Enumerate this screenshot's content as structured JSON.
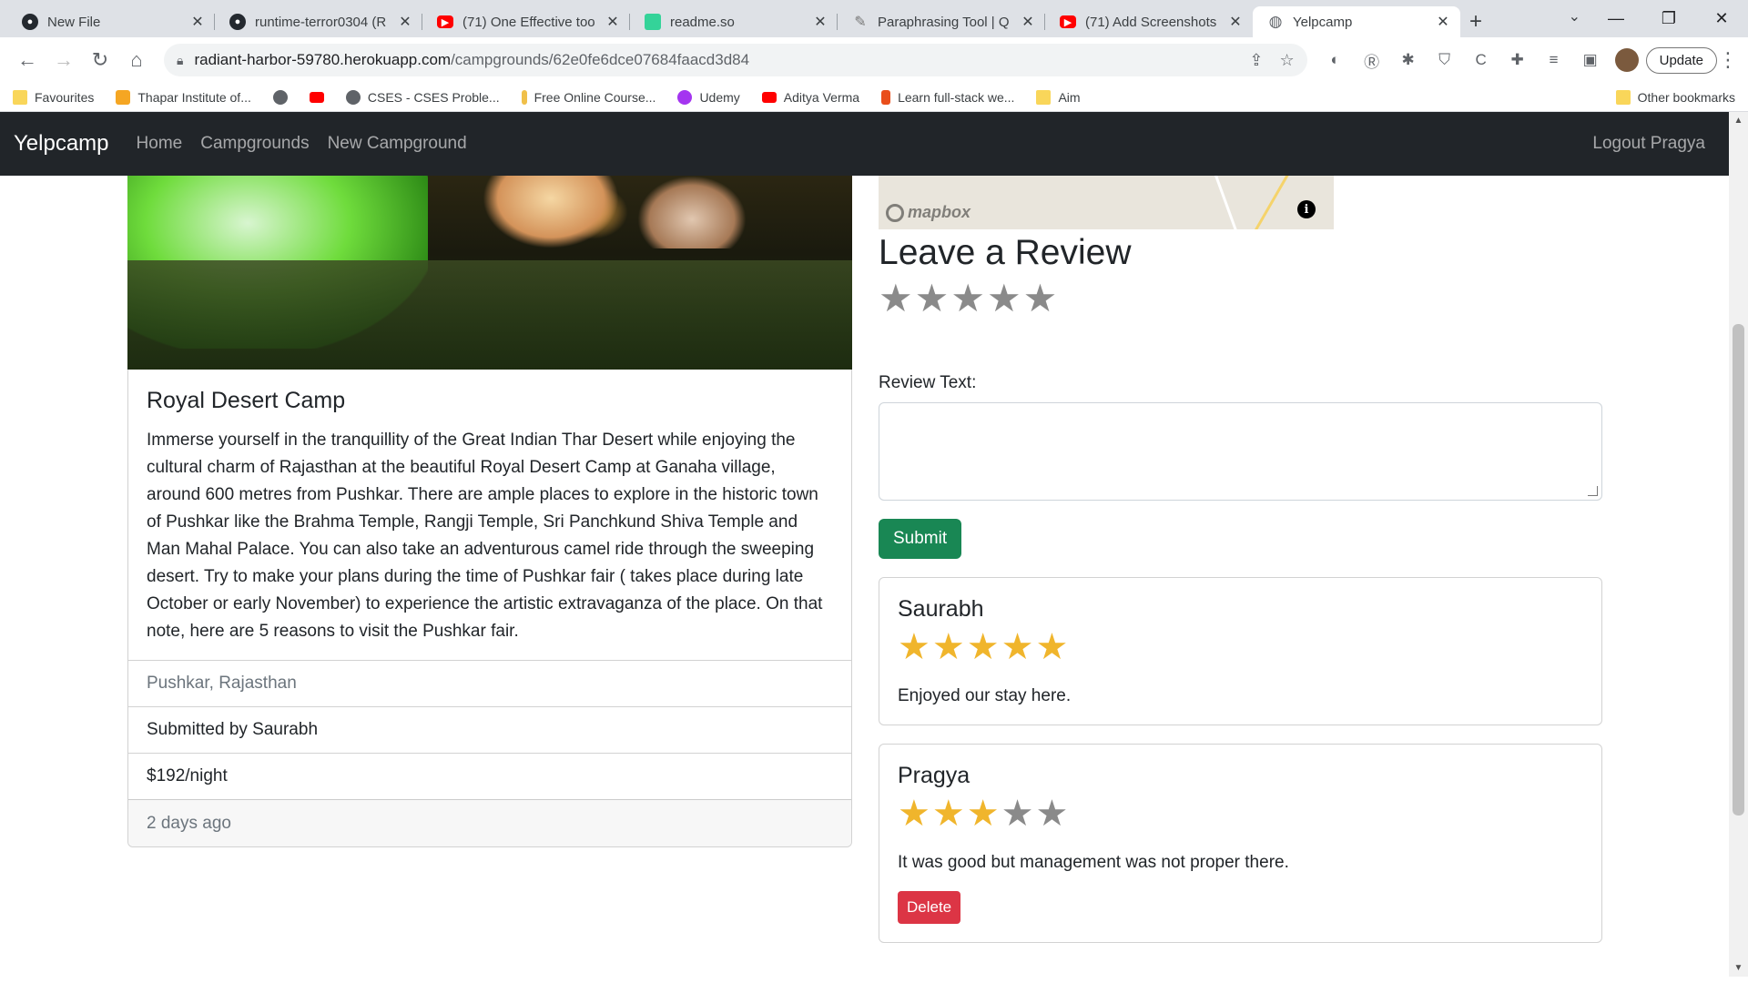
{
  "browser": {
    "tabs": [
      {
        "title": "New File",
        "icon": "github-icon",
        "color": "#24292f"
      },
      {
        "title": "runtime-terror0304 (R",
        "icon": "github-icon",
        "color": "#24292f"
      },
      {
        "title": "(71) One Effective too",
        "icon": "youtube-icon",
        "color": "#ff0000"
      },
      {
        "title": "readme.so",
        "icon": "readme-icon",
        "color": "#34d399"
      },
      {
        "title": "Paraphrasing Tool | Q",
        "icon": "quill-icon",
        "color": "#777777"
      },
      {
        "title": "(71) Add Screenshots",
        "icon": "youtube-icon",
        "color": "#ff0000"
      },
      {
        "title": "Yelpcamp",
        "icon": "globe-icon",
        "color": "#5f6368"
      }
    ],
    "url_host": "radiant-harbor-59780.herokuapp.com",
    "url_path": "/campgrounds/62e0fe6dce07684faacd3d84",
    "update_label": "Update",
    "bookmarks": [
      {
        "label": "Favourites",
        "icon": "folder-icon"
      },
      {
        "label": "Thapar Institute of...",
        "icon": "thapar-icon"
      },
      {
        "label": "",
        "icon": "globe-icon"
      },
      {
        "label": "",
        "icon": "youtube-icon"
      },
      {
        "label": "CSES - CSES Proble...",
        "icon": "globe-icon"
      },
      {
        "label": "Free Online Course...",
        "icon": "course-icon"
      },
      {
        "label": "Udemy",
        "icon": "udemy-icon"
      },
      {
        "label": "Aditya Verma",
        "icon": "youtube-icon"
      },
      {
        "label": "Learn full-stack we...",
        "icon": "coding-ninjas-icon"
      },
      {
        "label": "Aim",
        "icon": "folder-icon"
      }
    ],
    "other_bookmarks": "Other bookmarks"
  },
  "navbar": {
    "brand": "Yelpcamp",
    "links": [
      "Home",
      "Campgrounds",
      "New Campground"
    ],
    "logout": "Logout Pragya"
  },
  "campground": {
    "title": "Royal Desert Camp",
    "description": "Immerse yourself in the tranquillity of the Great Indian Thar Desert while enjoying the cultural charm of Rajasthan at the beautiful Royal Desert Camp at Ganaha village, around 600 metres from Pushkar. There are ample places to explore in the historic town of Pushkar like the Brahma Temple, Rangji Temple, Sri Panchkund Shiva Temple and Man Mahal Palace. You can also take an adventurous camel ride through the sweeping desert. Try to make your plans during the time of Pushkar fair ( takes place during late October or early November) to experience the artistic extravaganza of the place. On that note, here are 5 reasons to visit the Pushkar fair.",
    "location": "Pushkar, Rajasthan",
    "submitted_by": "Submitted by Saurabh",
    "price": "$192/night",
    "posted": "2 days ago"
  },
  "map": {
    "logo": "mapbox"
  },
  "review_form": {
    "heading": "Leave a Review",
    "rating": 0,
    "label": "Review Text:",
    "submit": "Submit"
  },
  "reviews": [
    {
      "author": "Saurabh",
      "rating": 5,
      "text": "Enjoyed our stay here.",
      "delete": ""
    },
    {
      "author": "Pragya",
      "rating": 3,
      "text": "It was good but management was not proper there.",
      "delete": "Delete"
    }
  ],
  "colors": {
    "star_on": "#f0b52c",
    "star_off": "#8a8a8a",
    "submit": "#198754",
    "delete": "#dc3545"
  }
}
